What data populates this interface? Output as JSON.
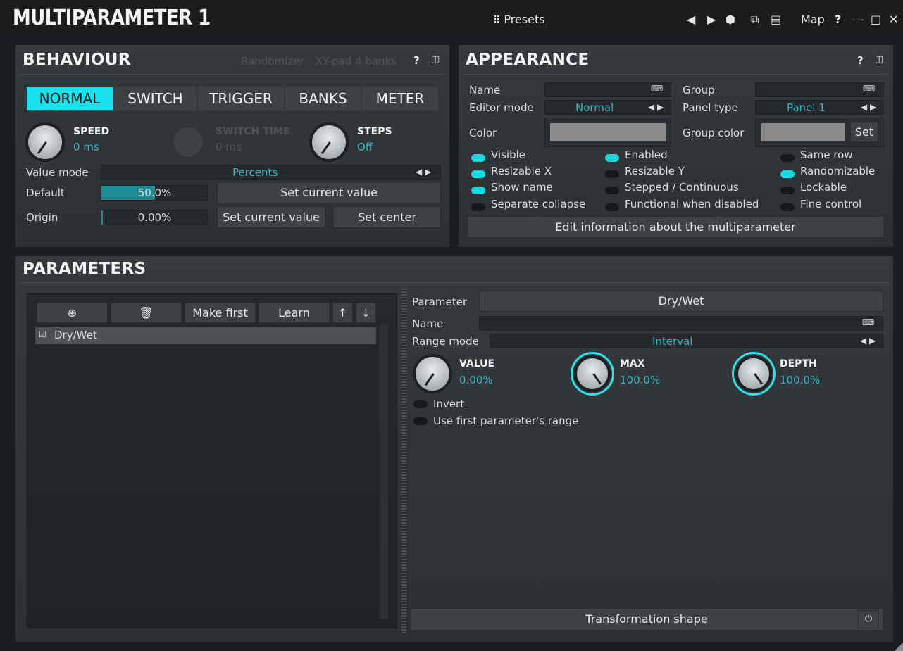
{
  "title": "MULTIPARAMETER 1",
  "topbar": {
    "presets": "Presets",
    "map": "Map",
    "help": "?",
    "minimize": "—",
    "maximize": "□",
    "close": "✕"
  },
  "behaviour": {
    "header": "BEHAVIOUR",
    "links": [
      "Randomizer",
      "XY-pad 4 banks"
    ],
    "tabs": [
      "NORMAL",
      "SWITCH",
      "TRIGGER",
      "BANKS",
      "METER"
    ],
    "active_tab": "NORMAL",
    "knobs": [
      {
        "label": "SPEED",
        "value": "0 ms"
      },
      {
        "label": "SWITCH TIME",
        "value": "0 ms"
      },
      {
        "label": "STEPS",
        "value": "Off"
      }
    ],
    "value_mode_label": "Value mode",
    "value_mode": "Percents",
    "default_label": "Default",
    "default_value": "50.0%",
    "default_fraction": 0.5,
    "origin_label": "Origin",
    "origin_value": "0.00%",
    "set_current_value": "Set current value",
    "set_current_value2": "Set current value",
    "set_center": "Set center"
  },
  "appearance": {
    "header": "APPEARANCE",
    "name_label": "Name",
    "group_label": "Group",
    "editor_mode_label": "Editor mode",
    "editor_mode": "Normal",
    "panel_type_label": "Panel type",
    "panel_type": "Panel 1",
    "color_label": "Color",
    "group_color_label": "Group color",
    "set_label": "Set",
    "toggles": [
      {
        "label": "Visible",
        "on": true
      },
      {
        "label": "Enabled",
        "on": true
      },
      {
        "label": "Same row",
        "on": false
      },
      {
        "label": "Resizable X",
        "on": true
      },
      {
        "label": "Resizable Y",
        "on": false
      },
      {
        "label": "Randomizable",
        "on": true
      },
      {
        "label": "Show name",
        "on": true
      },
      {
        "label": "Stepped / Continuous",
        "on": false
      },
      {
        "label": "Lockable",
        "on": false
      },
      {
        "label": "Separate collapse",
        "on": false
      },
      {
        "label": "Functional when disabled",
        "on": false
      },
      {
        "label": "Fine control",
        "on": false
      }
    ],
    "edit_info": "Edit information about the multiparameter"
  },
  "parameters": {
    "header": "PARAMETERS",
    "make_first": "Make first",
    "learn": "Learn",
    "list": [
      "Dry/Wet"
    ],
    "parameter_label": "Parameter",
    "parameter_value": "Dry/Wet",
    "name_label": "Name",
    "range_mode_label": "Range mode",
    "range_mode": "Interval",
    "knobs": [
      {
        "label": "VALUE",
        "value": "0.00%"
      },
      {
        "label": "MAX",
        "value": "100.0%"
      },
      {
        "label": "DEPTH",
        "value": "100.0%"
      }
    ],
    "invert": "Invert",
    "use_first_range": "Use first parameter's range",
    "transformation_shape": "Transformation shape"
  },
  "colors": {
    "accent": "#19d8e2",
    "panel": "#32373a",
    "background": "#1b1e20"
  }
}
